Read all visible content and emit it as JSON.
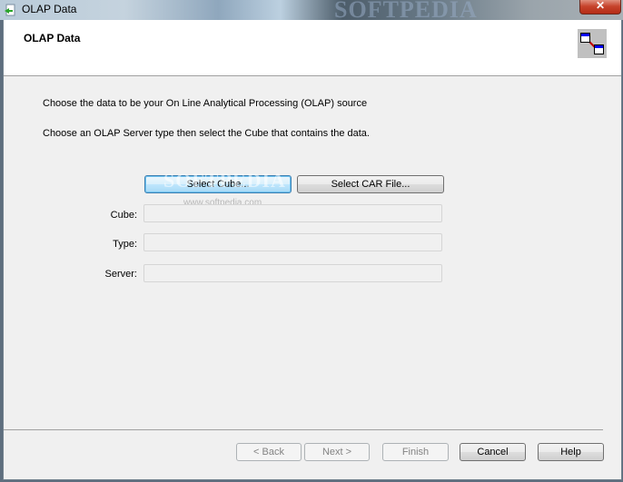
{
  "window": {
    "title": "OLAP Data",
    "close_label": "✕",
    "title_watermark": "SOFTPEDIA"
  },
  "header": {
    "title": "OLAP Data",
    "icon": "linked-tables-icon"
  },
  "body": {
    "description1": "Choose the data to be your On Line Analytical Processing (OLAP) source",
    "description2": "Choose an OLAP Server type then select the Cube that contains the data.",
    "select_cube_label": "Select Cube...",
    "select_car_label": "Select CAR File...",
    "watermark_big": "SOFTPEDIA",
    "watermark_small": "www.softpedia.com",
    "fields": [
      {
        "label": "Cube:",
        "value": ""
      },
      {
        "label": "Type:",
        "value": ""
      },
      {
        "label": "Server:",
        "value": ""
      }
    ]
  },
  "footer": {
    "back_label": "< Back",
    "next_label": "Next >",
    "finish_label": "Finish",
    "cancel_label": "Cancel",
    "help_label": "Help"
  }
}
